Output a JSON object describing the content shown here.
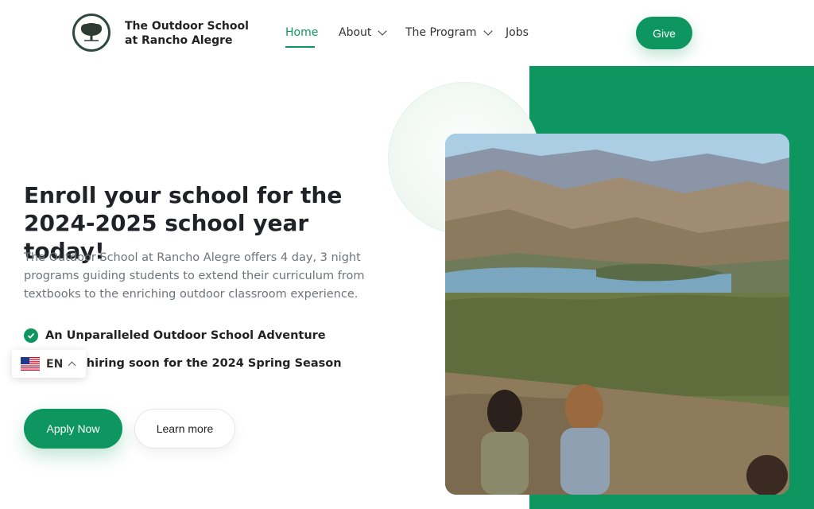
{
  "header": {
    "brand_line1": "The Outdoor School",
    "brand_line2": "at Rancho Alegre",
    "nav": [
      {
        "label": "Home",
        "active": true
      },
      {
        "label": "About",
        "dropdown": true
      },
      {
        "label": "The Program",
        "dropdown": true
      },
      {
        "label": "Jobs"
      }
    ],
    "give_label": "Give"
  },
  "hero": {
    "title_line1": "Enroll your school for the",
    "title_line2": "2024-2025 school year today!",
    "description": "The Outdoor School at Rancho Alegre offers 4 day, 3 night programs guiding students to extend their curriculum from textbooks to the enriching outdoor classroom experience.",
    "features": [
      "An Unparalleled Outdoor School Adventure",
      "We're hiring soon for the 2024 Spring Season"
    ],
    "apply_label": "Apply Now",
    "learn_label": "Learn more",
    "photo_icon": "landscape-photo"
  },
  "language": {
    "code": "EN",
    "flag_icon": "us-flag-icon"
  },
  "colors": {
    "accent": "#0e9660",
    "text": "#1f2328",
    "muted": "#6f7378"
  }
}
